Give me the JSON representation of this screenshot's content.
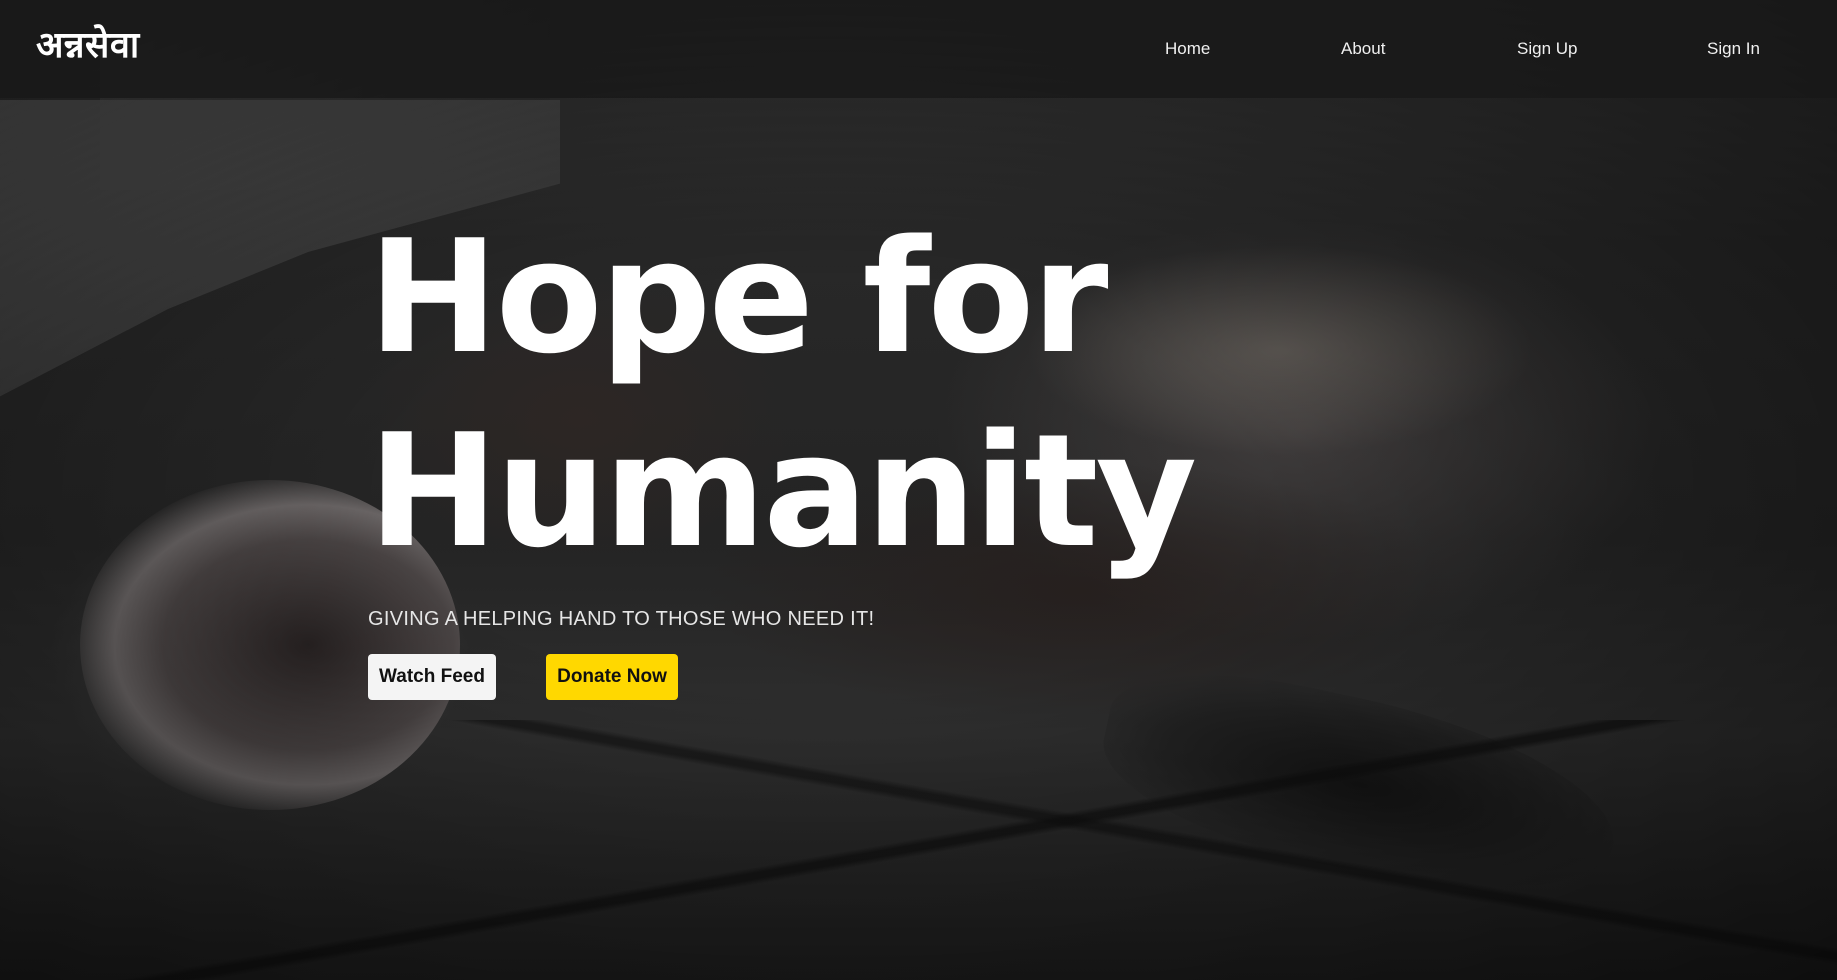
{
  "navbar": {
    "logo": "अन्नसेवा",
    "links": [
      "Home",
      "About",
      "Sign Up",
      "Sign In"
    ]
  },
  "hero": {
    "headline_line1": "Hope for",
    "headline_line2": "Humanity",
    "subheading": "GIVING A HELPING HAND TO THOSE WHO NEED IT!",
    "watch_label": "Watch Feed",
    "donate_label": "Donate Now"
  },
  "colors": {
    "donate_button": "#ffd800",
    "watch_button": "#f4f4f4",
    "navbar_bg": "#181818"
  }
}
